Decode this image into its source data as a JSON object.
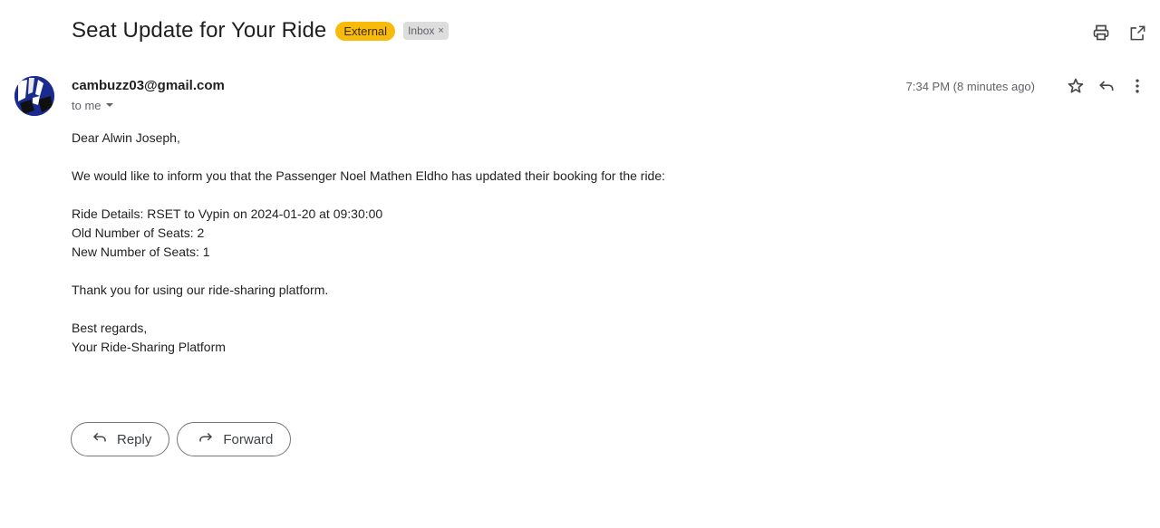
{
  "email": {
    "subject": "Seat Update for Your Ride",
    "labels": {
      "external": "External",
      "inbox": "Inbox",
      "inbox_remove": "×"
    },
    "sender": "cambuzz03@gmail.com",
    "recipient": "to me",
    "time": "7:34 PM (8 minutes ago)",
    "body": {
      "greeting": "Dear Alwin Joseph,",
      "intro": "We would like to inform you that the Passenger Noel Mathen Eldho has updated their booking for the ride:",
      "ride_details": "Ride Details: RSET to Vypin on 2024-01-20 at 09:30:00",
      "old_seats": "Old Number of Seats: 2",
      "new_seats": "New Number of Seats: 1",
      "thanks": "Thank you for using our ride-sharing platform.",
      "closing": "Best regards,",
      "signature": "Your Ride-Sharing Platform"
    }
  },
  "actions": {
    "reply_label": "Reply",
    "forward_label": "Forward"
  },
  "icons": {
    "print": "print-icon",
    "open_new_window": "open-in-new-window-icon",
    "star": "star-icon",
    "reply": "reply-icon",
    "more": "more-vertical-icon",
    "dropdown": "caret-down-icon"
  },
  "colors": {
    "external_badge": "#f9bb0b",
    "inbox_badge": "#dddddd",
    "avatar": "#1b2a8f"
  }
}
